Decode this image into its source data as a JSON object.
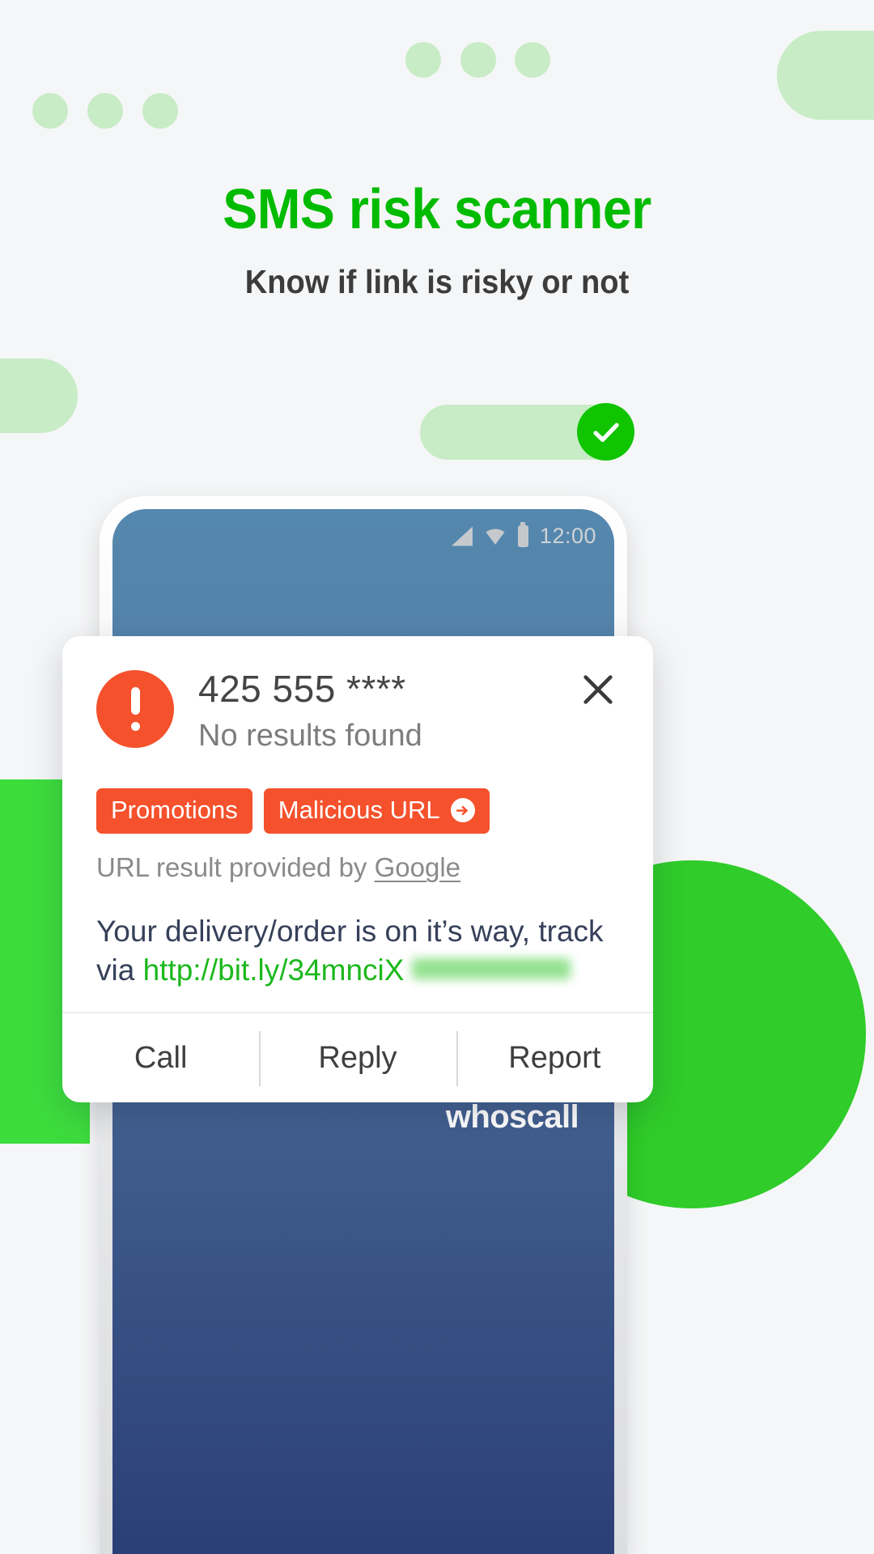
{
  "hero": {
    "headline": "SMS risk scanner",
    "subhead": "Know if link is risky or not",
    "headline_color": "#00bb00",
    "subhead_color": "#3c3c3c",
    "background_color": "#f5f6f7",
    "accent_green": "#3ddc3d",
    "pale_green": "#c8ecc6"
  },
  "phone": {
    "status_bar": {
      "time": "12:00",
      "icons": [
        "signal-icon",
        "wifi-icon",
        "battery-icon"
      ]
    },
    "brand": "whoscall"
  },
  "card": {
    "warning_icon": "exclamation-icon",
    "warning_color": "#f4512c",
    "phone_number": "425 555 ****",
    "result_status": "No results found",
    "close_icon": "close-icon",
    "tags": [
      {
        "label": "Promotions",
        "has_arrow": false
      },
      {
        "label": "Malicious URL",
        "has_arrow": true,
        "arrow_icon": "arrow-right-circle-icon"
      }
    ],
    "attribution_prefix": "URL result provided by ",
    "attribution_source": "Google",
    "sms_text": "Your delivery/order is on it’s way, track via ",
    "sms_link": "http://bit.ly/34mnciX",
    "sms_link_color": "#1db81d",
    "actions": [
      {
        "label": "Call"
      },
      {
        "label": "Reply"
      },
      {
        "label": "Report"
      }
    ]
  }
}
